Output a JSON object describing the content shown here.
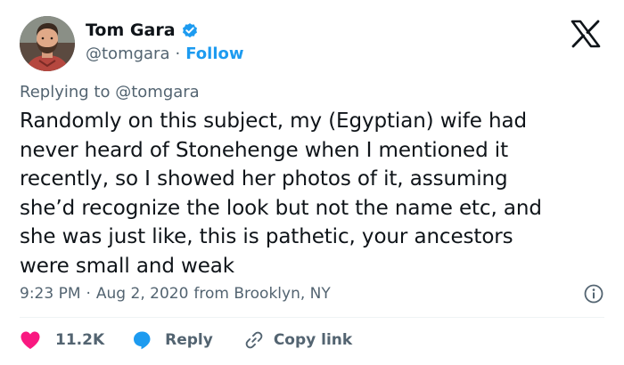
{
  "author": {
    "display_name": "Tom Gara",
    "handle": "@tomgara",
    "separator": "·",
    "follow_label": "Follow",
    "verified": true
  },
  "brand": {
    "logo_icon": "x-logo-icon"
  },
  "reply_context": {
    "prefix": "Replying to",
    "mention": "@tomgara"
  },
  "tweet": {
    "text": "Randomly on this subject, my (Egyptian) wife had\nnever heard of Stonehenge when I mentioned it\nrecently, so I showed her photos of it, assuming\nshe’d recognize the look but not the name etc, and\nshe was just like, this is pathetic, your ancestors\nwere small and weak"
  },
  "meta": {
    "time": "9:23 PM",
    "separator": "·",
    "date": "Aug 2, 2020",
    "location": "from Brooklyn, NY",
    "info_icon": "info-icon"
  },
  "actions": {
    "like_count": "11.2K",
    "reply_label": "Reply",
    "copy_link_label": "Copy link"
  },
  "colors": {
    "accent": "#1d9bf0",
    "like": "#f91880",
    "text": "#0f1419",
    "secondary": "#536471"
  }
}
